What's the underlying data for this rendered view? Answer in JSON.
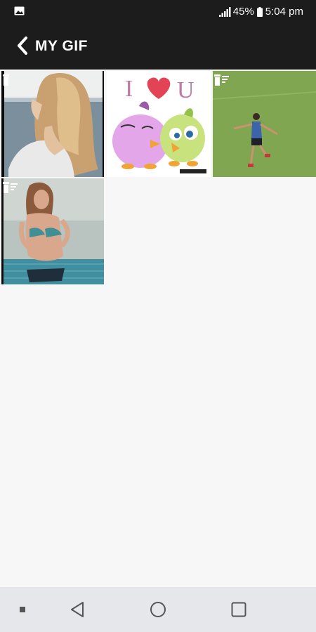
{
  "status_bar": {
    "battery_percent": "45%",
    "time": "5:04 pm",
    "icons": [
      "gallery-icon",
      "signal-icon",
      "battery-icon"
    ]
  },
  "app_bar": {
    "title": "MY GIF",
    "back_icon": "chevron-left-icon"
  },
  "gifs": [
    {
      "subject": "woman with long wavy hair by the sea",
      "badge_icon": "gif-list-icon"
    },
    {
      "subject": "cartoon birds with heart",
      "caption": "I U",
      "badge_icon": "gif-list-icon"
    },
    {
      "subject": "soccer player celebrating on grass field",
      "badge_icon": "gif-list-icon"
    },
    {
      "subject": "woman in bikini by pool",
      "badge_icon": "gif-list-icon"
    }
  ],
  "nav_bar": {
    "items": [
      "dot-icon",
      "back-triangle-icon",
      "home-circle-icon",
      "recents-square-icon"
    ]
  },
  "colors": {
    "bar_background": "#1c1c1c",
    "content_background": "#f7f7f7",
    "nav_background": "#e5e7eb"
  }
}
